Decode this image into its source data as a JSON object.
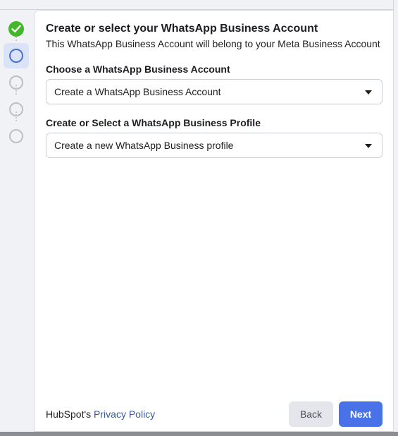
{
  "stepper": {
    "steps": [
      {
        "state": "done",
        "icon": "check-icon"
      },
      {
        "state": "current"
      },
      {
        "state": "todo"
      },
      {
        "state": "todo"
      },
      {
        "state": "todo"
      }
    ]
  },
  "header": {
    "title": "Create or select your WhatsApp Business Account",
    "subtitle": "This WhatsApp Business Account will belong to your Meta Business Account"
  },
  "fields": {
    "account": {
      "label": "Choose a WhatsApp Business Account",
      "selected": "Create a WhatsApp Business Account"
    },
    "profile": {
      "label": "Create or Select a WhatsApp Business Profile",
      "selected": "Create a new WhatsApp Business profile"
    }
  },
  "footer": {
    "prefix": "HubSpot's",
    "link": "Privacy Policy",
    "back_label": "Back",
    "next_label": "Next"
  },
  "colors": {
    "accent": "#4a72e8",
    "success": "#42b72a",
    "link": "#385898"
  }
}
